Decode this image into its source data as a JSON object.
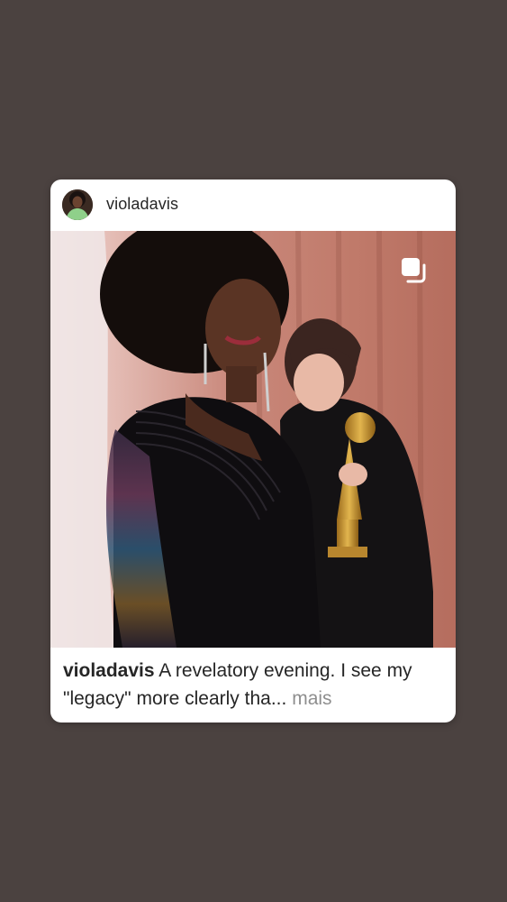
{
  "post": {
    "username": "violadavis",
    "caption": {
      "username": "violadavis",
      "text": "A revelatory evening. I see my \"legacy\" more clearly tha",
      "ellipsis": "...",
      "more_label": "mais"
    },
    "carousel_icon": "multiple-images-icon",
    "avatar_icon": "profile-avatar",
    "image_description_icon": "photo"
  },
  "colors": {
    "background": "#4b4240",
    "card": "#ffffff",
    "text": "#262626",
    "muted": "#8e8e8e"
  }
}
